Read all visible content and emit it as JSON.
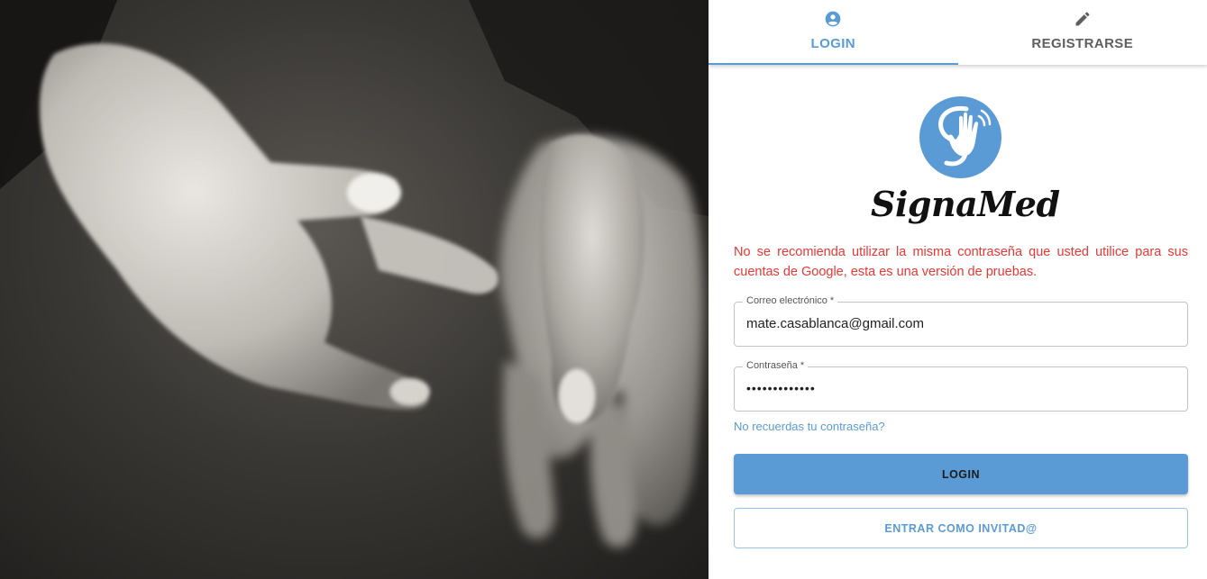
{
  "photo": {
    "description_icon": "sign-language-hands-photo"
  },
  "tabs": [
    {
      "label": "LOGIN",
      "icon": "account-circle-icon",
      "active": true
    },
    {
      "label": "REGISTRARSE",
      "icon": "pencil-icon",
      "active": false
    }
  ],
  "brand": {
    "name": "SignaMed",
    "logo_icon": "hand-wave-logo-icon"
  },
  "warning": "No se recomienda utilizar la misma contraseña que usted utilice para sus cuentas de Google, esta es una versión de pruebas.",
  "form": {
    "email_label": "Correo electrónico *",
    "email_value": "mate.casablanca@gmail.com",
    "password_label": "Contraseña *",
    "password_value": "•••••••••••••",
    "forgot_link": "No recuerdas tu contraseña?",
    "login_button": "LOGIN",
    "guest_button": "ENTRAR COMO INVITAD@"
  },
  "colors": {
    "accent": "#5b9bd5",
    "warning": "#e53935",
    "tab_inactive": "#5f5f5f"
  }
}
